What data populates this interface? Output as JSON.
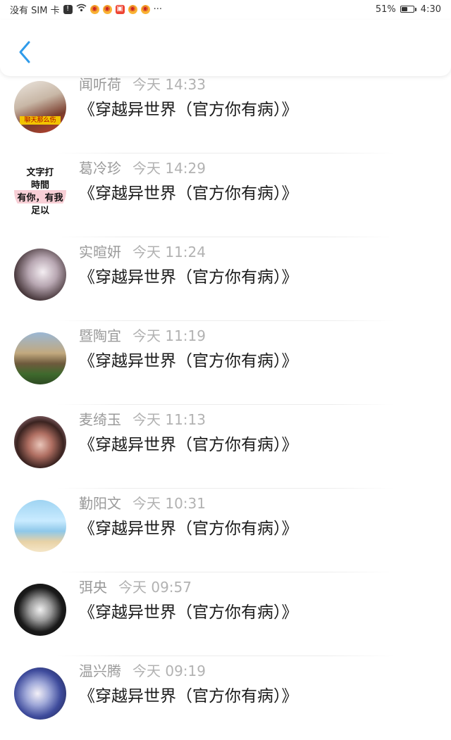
{
  "status_bar": {
    "carrier": "没有 SIM 卡",
    "overflow": "···",
    "battery_percent": "51%",
    "battery_level": 0.51,
    "time": "4:30"
  },
  "header": {
    "back_icon": "chevron-left-icon",
    "accent_color": "#2f9bea"
  },
  "comments": [
    {
      "name": "闻听荷",
      "time": "今天 14:33",
      "message": "《穿越异世界（官方你有病）》",
      "avatar_caption": "聊天那么伤"
    },
    {
      "name": "葛冷珍",
      "time": "今天 14:29",
      "message": "《穿越异世界（官方你有病）》",
      "avatar_lines": [
        "文字打",
        "時間",
        "有你，有我",
        "足以"
      ]
    },
    {
      "name": "实暄妍",
      "time": "今天 11:24",
      "message": "《穿越异世界（官方你有病）》"
    },
    {
      "name": "暨陶宜",
      "time": "今天 11:19",
      "message": "《穿越异世界（官方你有病）》"
    },
    {
      "name": "麦绮玉",
      "time": "今天 11:13",
      "message": "《穿越异世界（官方你有病）》"
    },
    {
      "name": "勤阳文",
      "time": "今天 10:31",
      "message": "《穿越异世界（官方你有病）》"
    },
    {
      "name": "弭央",
      "time": "今天 09:57",
      "message": "《穿越异世界（官方你有病）》"
    },
    {
      "name": "温兴腾",
      "time": "今天 09:19",
      "message": "《穿越异世界（官方你有病）》"
    }
  ]
}
